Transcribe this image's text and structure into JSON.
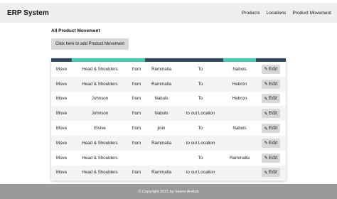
{
  "app": {
    "title": "ERP System"
  },
  "nav": {
    "items": [
      "Products",
      "Locations",
      "Product Movement"
    ]
  },
  "page": {
    "title": "All Product Movement",
    "add_button": "Click here to add Product Movement"
  },
  "colors": {
    "strip": [
      "#34495e",
      "#48c9b0",
      "#48c9b0",
      "#34495e",
      "#34495e",
      "#48c9b0",
      "#34495e"
    ]
  },
  "table": {
    "rows": [
      [
        "Move",
        "Head & Shoulders",
        "from",
        "Rammalla",
        "To",
        "Nabuls"
      ],
      [
        "Move",
        "Head & Shoulders",
        "from",
        "Rammalla",
        "To",
        "Hebron"
      ],
      [
        "Move",
        "Johnson",
        "from",
        "Nabuls",
        "To",
        "Hebron"
      ],
      [
        "Move",
        "Johnson",
        "from",
        "Nabuls",
        "to out Location",
        ""
      ],
      [
        "Move",
        "Elvive",
        "from",
        "jinin",
        "To",
        "Nabuls"
      ],
      [
        "Move",
        "Head & Shoulders",
        "from",
        "Rammalla",
        "to out Location",
        ""
      ],
      [
        "Move",
        "Head & Shoulders",
        "",
        "",
        "To",
        "Rammalla"
      ],
      [
        "Move",
        "Head & Shoulders",
        "from",
        "Rammalla",
        "to out Location",
        ""
      ]
    ],
    "edit_label": "Edit",
    "edit_icon": "edit-icon"
  },
  "footer": {
    "text": "© Copyright 2021 by hatem Al-Rub"
  }
}
